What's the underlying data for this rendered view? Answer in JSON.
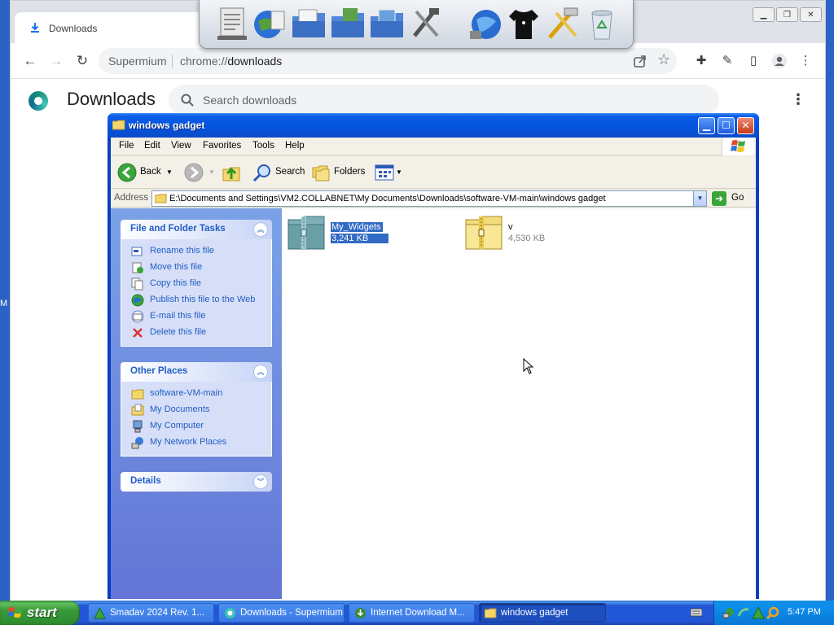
{
  "chrome": {
    "tab_title": "Downloads",
    "omnibox_site": "Supermium",
    "omnibox_url_prefix": "chrome://",
    "omnibox_url_host": "downloads",
    "page_title": "Downloads",
    "search_placeholder": "Search downloads"
  },
  "explorer": {
    "window_title": "windows gadget",
    "menu": [
      "File",
      "Edit",
      "View",
      "Favorites",
      "Tools",
      "Help"
    ],
    "toolbar": {
      "back": "Back",
      "search": "Search",
      "folders": "Folders"
    },
    "address_label": "Address",
    "address_value": "E:\\Documents and Settings\\VM2.COLLABNET\\My Documents\\Downloads\\software-VM-main\\windows gadget",
    "go_label": "Go",
    "panels": {
      "file_tasks": {
        "title": "File and Folder Tasks",
        "items": [
          {
            "label": "Rename this file",
            "icon": "rename-icon"
          },
          {
            "label": "Move this file",
            "icon": "move-icon"
          },
          {
            "label": "Copy this file",
            "icon": "copy-icon"
          },
          {
            "label": "Publish this file to the Web",
            "icon": "globe-icon"
          },
          {
            "label": "E-mail this file",
            "icon": "email-icon"
          },
          {
            "label": "Delete this file",
            "icon": "delete-icon"
          }
        ]
      },
      "other_places": {
        "title": "Other Places",
        "items": [
          {
            "label": "software-VM-main",
            "icon": "folder-icon"
          },
          {
            "label": "My Documents",
            "icon": "my-documents-icon"
          },
          {
            "label": "My Computer",
            "icon": "my-computer-icon"
          },
          {
            "label": "My Network Places",
            "icon": "network-places-icon"
          }
        ]
      },
      "details": {
        "title": "Details"
      }
    },
    "files": [
      {
        "name": "My_Widgets",
        "size": "3,241 KB",
        "selected": true
      },
      {
        "name": "v",
        "size": "4,530 KB",
        "selected": false
      }
    ]
  },
  "desktop": {
    "edge_text": "M"
  },
  "taskbar": {
    "start_label": "start",
    "buttons": [
      {
        "label": "Smadav 2024 Rev. 1...",
        "icon": "smadav-icon"
      },
      {
        "label": "Downloads - Supermium",
        "icon": "supermium-icon"
      },
      {
        "label": "Internet Download M...",
        "icon": "idm-icon"
      },
      {
        "label": "windows gadget",
        "icon": "folder-icon",
        "active": true
      }
    ],
    "clock": "5:47 PM"
  }
}
